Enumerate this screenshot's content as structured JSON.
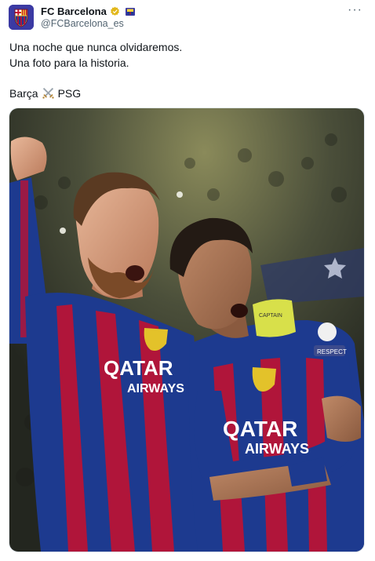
{
  "account": {
    "display_name": "FC Barcelona",
    "handle": "@FCBarcelona_es",
    "verified_icon": "gold-verified-badge-icon",
    "affiliation_icon": "barcelona-crest-icon"
  },
  "menu": {
    "more_label": "···"
  },
  "tweet": {
    "line1": "Una noche que nunca olvidaremos.",
    "line2": "Una foto para la historia.",
    "line3_left": "Barça",
    "line3_icon": "crossed-swords-icon",
    "line3_right": "PSG"
  },
  "photo": {
    "left_shirt_sponsor_line1": "QATAR",
    "left_shirt_sponsor_line2": "AIRWAYS",
    "right_shirt_sponsor_line1": "QATAR",
    "right_shirt_sponsor_line2": "AIRWAYS",
    "sleeve_badge": "RESPECT",
    "captain_band": "CAPTAIN",
    "colors": {
      "blaugrana_blue": "#1d3a8f",
      "blaugrana_red": "#b0153a",
      "gold": "#e3c22a"
    }
  }
}
